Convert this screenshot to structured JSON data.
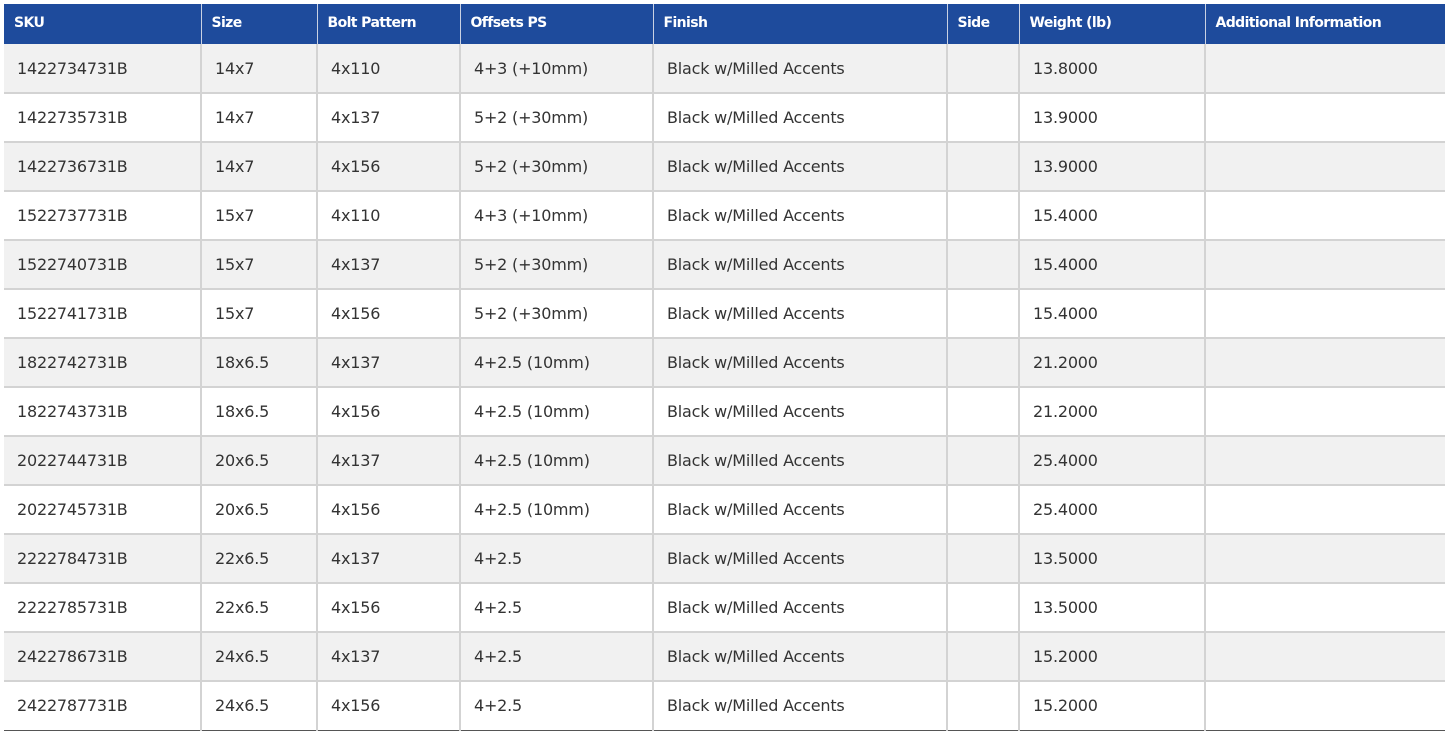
{
  "table": {
    "headers": [
      "SKU",
      "Size",
      "Bolt Pattern",
      "Offsets PS",
      "Finish",
      "Side",
      "Weight (lb)",
      "Additional Information"
    ],
    "rows": [
      [
        "1422734731B",
        "14x7",
        "4x110",
        "4+3 (+10mm)",
        "Black w/Milled Accents",
        "",
        "13.8000",
        ""
      ],
      [
        "1422735731B",
        "14x7",
        "4x137",
        "5+2 (+30mm)",
        "Black w/Milled Accents",
        "",
        "13.9000",
        ""
      ],
      [
        "1422736731B",
        "14x7",
        "4x156",
        "5+2 (+30mm)",
        "Black w/Milled Accents",
        "",
        "13.9000",
        ""
      ],
      [
        "1522737731B",
        "15x7",
        "4x110",
        "4+3 (+10mm)",
        "Black w/Milled Accents",
        "",
        "15.4000",
        ""
      ],
      [
        "1522740731B",
        "15x7",
        "4x137",
        "5+2 (+30mm)",
        "Black w/Milled Accents",
        "",
        "15.4000",
        ""
      ],
      [
        "1522741731B",
        "15x7",
        "4x156",
        "5+2 (+30mm)",
        "Black w/Milled Accents",
        "",
        "15.4000",
        ""
      ],
      [
        "1822742731B",
        "18x6.5",
        "4x137",
        "4+2.5 (10mm)",
        "Black w/Milled Accents",
        "",
        "21.2000",
        ""
      ],
      [
        "1822743731B",
        "18x6.5",
        "4x156",
        "4+2.5 (10mm)",
        "Black w/Milled Accents",
        "",
        "21.2000",
        ""
      ],
      [
        "2022744731B",
        "20x6.5",
        "4x137",
        "4+2.5 (10mm)",
        "Black w/Milled Accents",
        "",
        "25.4000",
        ""
      ],
      [
        "2022745731B",
        "20x6.5",
        "4x156",
        "4+2.5 (10mm)",
        "Black w/Milled Accents",
        "",
        "25.4000",
        ""
      ],
      [
        "2222784731B",
        "22x6.5",
        "4x137",
        "4+2.5",
        "Black w/Milled Accents",
        "",
        "13.5000",
        ""
      ],
      [
        "2222785731B",
        "22x6.5",
        "4x156",
        "4+2.5",
        "Black w/Milled Accents",
        "",
        "13.5000",
        ""
      ],
      [
        "2422786731B",
        "24x6.5",
        "4x137",
        "4+2.5",
        "Black w/Milled Accents",
        "",
        "15.2000",
        ""
      ],
      [
        "2422787731B",
        "24x6.5",
        "4x156",
        "4+2.5",
        "Black w/Milled Accents",
        "",
        "15.2000",
        ""
      ]
    ]
  },
  "colors": {
    "header_background": "#1e4b9c",
    "header_text": "#ffffff",
    "row_stripe": "#f1f1f1",
    "grid_line": "#d3d3d3",
    "cell_text": "#333333"
  }
}
